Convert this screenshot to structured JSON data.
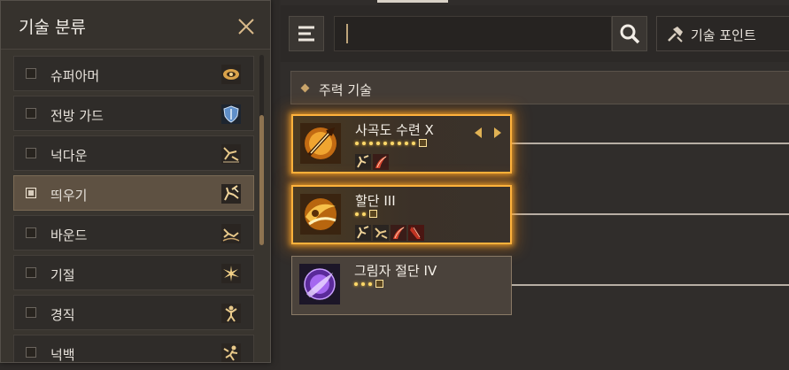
{
  "category_panel": {
    "title": "기술 분류",
    "items": [
      {
        "label": "슈퍼아머",
        "checked": false,
        "icon": "super-armor-icon"
      },
      {
        "label": "전방 가드",
        "checked": false,
        "icon": "front-guard-icon"
      },
      {
        "label": "넉다운",
        "checked": false,
        "icon": "knockdown-icon"
      },
      {
        "label": "띄우기",
        "checked": true,
        "icon": "float-icon"
      },
      {
        "label": "바운드",
        "checked": false,
        "icon": "bound-icon"
      },
      {
        "label": "기절",
        "checked": false,
        "icon": "stun-icon"
      },
      {
        "label": "경직",
        "checked": false,
        "icon": "stiffness-icon"
      },
      {
        "label": "넉백",
        "checked": false,
        "icon": "knockback-icon"
      }
    ]
  },
  "toolbar": {
    "search_placeholder": "",
    "skill_point_label": "기술 포인트"
  },
  "section": {
    "title": "주력 기술"
  },
  "skills": [
    {
      "name": "사곡도 수련 X",
      "level_dots": 10,
      "highlighted": true,
      "has_arrows": true,
      "tags": [
        "float-icon",
        "slash-icon"
      ]
    },
    {
      "name": "할단 III",
      "level_dots": 3,
      "highlighted": true,
      "has_arrows": false,
      "tags": [
        "float-icon",
        "knockdown-icon",
        "slash-icon",
        "red-slash-icon"
      ]
    },
    {
      "name": "그림자 절단 IV",
      "level_dots": 4,
      "highlighted": false,
      "has_arrows": false,
      "tags": []
    }
  ],
  "colors": {
    "accent_gold": "#ffb23c",
    "selected_item": "#5e5142",
    "scroll_thumb": "#8e7350"
  }
}
